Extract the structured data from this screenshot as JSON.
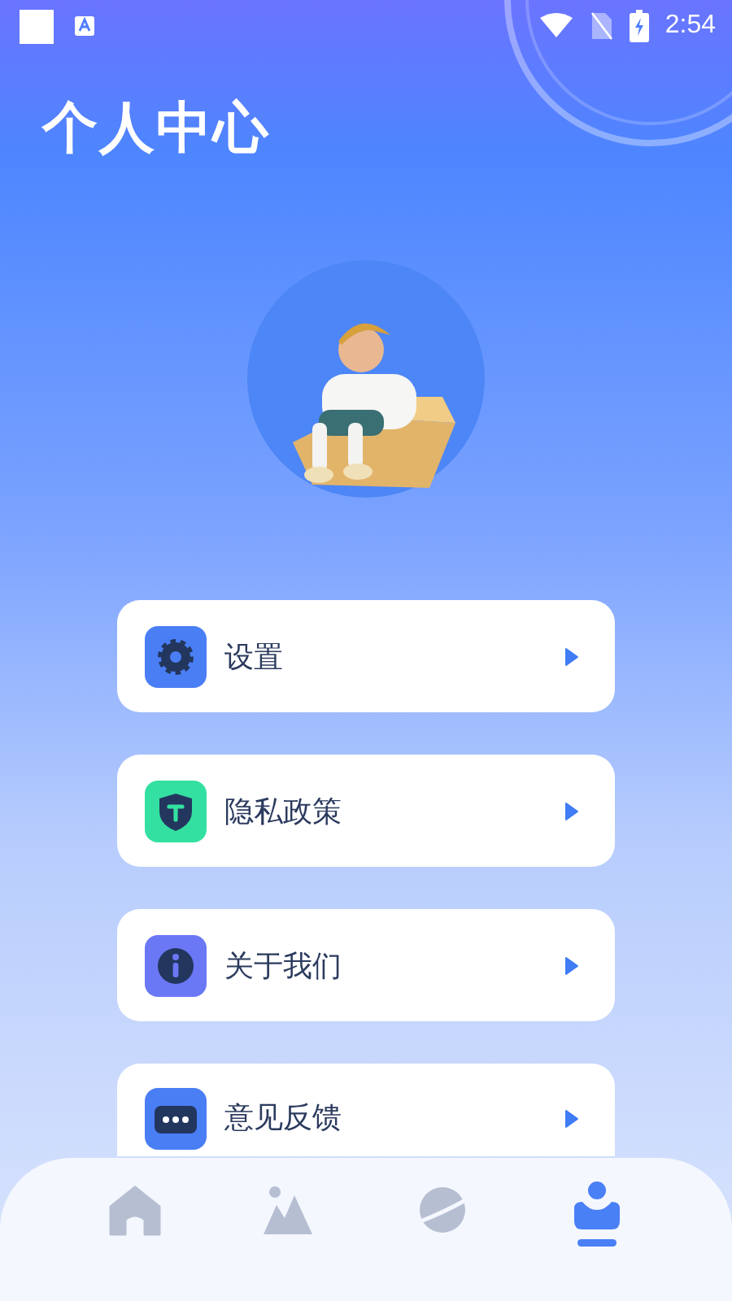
{
  "status_bar": {
    "time": "2:54"
  },
  "title": "个人中心",
  "menu": [
    {
      "label": "设置",
      "color": "#4a7ef5"
    },
    {
      "label": "隐私政策",
      "color": "#34e0a1"
    },
    {
      "label": "关于我们",
      "color": "#6b78f5"
    },
    {
      "label": "意见反馈",
      "color": "#4a7ef5"
    }
  ],
  "tabs": [
    {
      "selected": false
    },
    {
      "selected": false
    },
    {
      "selected": false
    },
    {
      "selected": true
    }
  ]
}
